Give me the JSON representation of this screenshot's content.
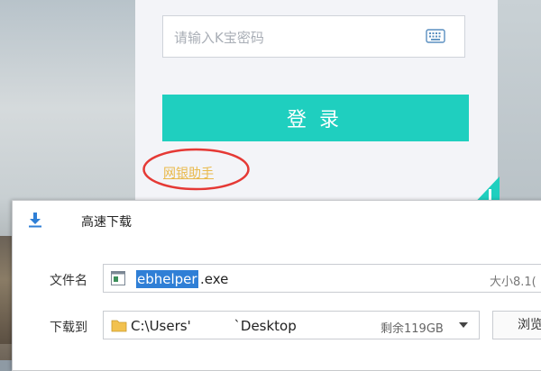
{
  "login": {
    "password_placeholder": "请输入K宝密码",
    "keyboard_icon": "keyboard-icon",
    "login_button": "登录",
    "helper_link": "网银助手",
    "highlight_color": "#e53935",
    "button_color": "#1fcfbf"
  },
  "download_dialog": {
    "title": "高速下载",
    "download_icon": "download-arrow-icon",
    "filename_label": "文件名",
    "filename_selected": "ebhelper",
    "filename_ext": ".exe",
    "size_text": "大小8.1(",
    "save_to_label": "下载到",
    "path": "C:\\Users'          `Desktop",
    "free_space": "剩余119GB",
    "browse_label": "浏览"
  }
}
